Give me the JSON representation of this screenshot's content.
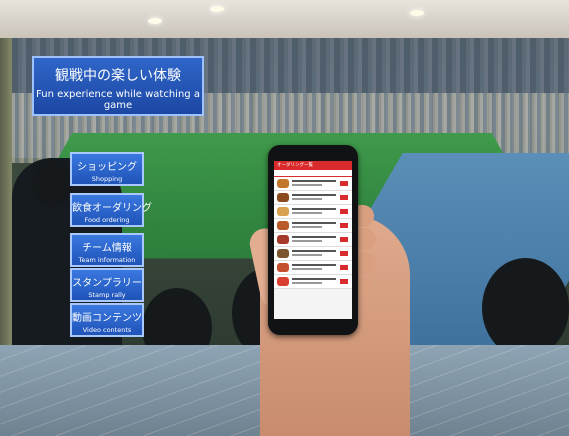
{
  "panel": {
    "title_jp": "観戦中の楽しい体験",
    "title_en": "Fun experience while watching a game"
  },
  "menu": [
    {
      "jp": "ショッピング",
      "en": "Shopping"
    },
    {
      "jp": "飲食オーダリング",
      "en": "Food ordering"
    },
    {
      "jp": "チーム情報",
      "en": "Team information"
    },
    {
      "jp": "スタンプラリー",
      "en": "Stamp rally"
    },
    {
      "jp": "動画コンテンツ",
      "en": "Video contents"
    }
  ],
  "phone": {
    "app_title": "オーダリング一覧"
  }
}
